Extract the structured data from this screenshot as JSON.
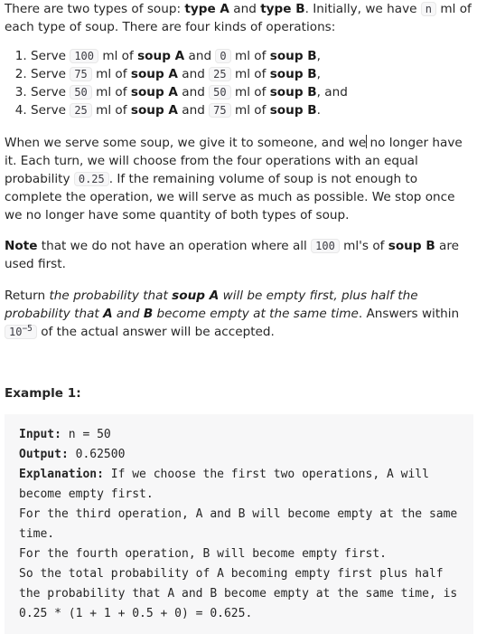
{
  "intro": {
    "t1": "There are two types of soup: ",
    "typeA": "type A",
    "t2": " and ",
    "typeB": "type B",
    "t3": ". Initially, we have ",
    "n": "n",
    "t4": " ml of each type of soup. There are four kinds of operations:"
  },
  "operations": [
    {
      "pre": "Serve ",
      "a": "100",
      "mid": " ml of ",
      "soupA": "soup A",
      "and": " and ",
      "b": "0",
      "mid2": " ml of ",
      "soupB": "soup B",
      "end": ","
    },
    {
      "pre": "Serve ",
      "a": "75",
      "mid": " ml of ",
      "soupA": "soup A",
      "and": " and ",
      "b": "25",
      "mid2": " ml of ",
      "soupB": "soup B",
      "end": ","
    },
    {
      "pre": "Serve ",
      "a": "50",
      "mid": " ml of ",
      "soupA": "soup A",
      "and": " and ",
      "b": "50",
      "mid2": " ml of ",
      "soupB": "soup B",
      "end": ", and"
    },
    {
      "pre": "Serve ",
      "a": "25",
      "mid": " ml of ",
      "soupA": "soup A",
      "and": " and ",
      "b": "75",
      "mid2": " ml of ",
      "soupB": "soup B",
      "end": "."
    }
  ],
  "para2": {
    "t1": "When we serve some soup, we give it to someone, and we",
    "t2": " no longer have it. Each turn, we will choose from the four operations with an equal probability ",
    "prob": "0.25",
    "t3": ". If the remaining volume of soup is not enough to complete the operation, we will serve as much as possible. We stop once we no longer have some quantity of both types of soup."
  },
  "para3": {
    "note": "Note",
    "t1": " that we do not have an operation where all ",
    "amt": "100",
    "t2": " ml's of ",
    "soupB": "soup B",
    "t3": " are used first."
  },
  "para4": {
    "t1": "Return ",
    "i1": "the probability that ",
    "soupA": "soup A",
    "i2": " will be empty first, plus half the probability that ",
    "A": "A",
    "i3": " and ",
    "B": "B",
    "i4": " become empty at the same time",
    "t2": ". Answers within ",
    "base": "10",
    "exp": "−5",
    "t3": " of the actual answer will be accepted."
  },
  "example": {
    "title": "Example 1:",
    "input_label": "Input:",
    "input_value": " n = 50",
    "output_label": "Output:",
    "output_value": " 0.62500",
    "expl_label": "Explanation:",
    "expl_text": " If we choose the first two operations, A will become empty first.\nFor the third operation, A and B will become empty at the same time.\nFor the fourth operation, B will become empty first.\nSo the total probability of A becoming empty first plus half the probability that A and B become empty at the same time, is 0.25 * (1 + 1 + 0.5 + 0) = 0.625."
  }
}
